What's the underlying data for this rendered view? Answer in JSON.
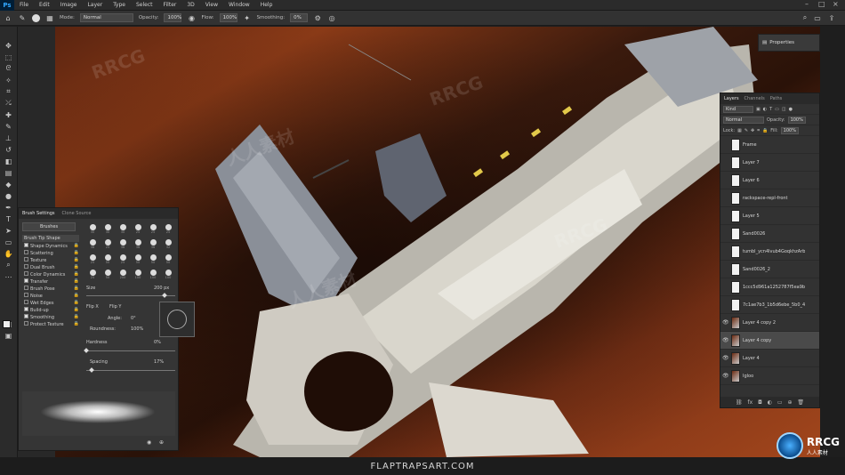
{
  "menu": {
    "logo": "Ps",
    "items": [
      "File",
      "Edit",
      "Image",
      "Layer",
      "Type",
      "Select",
      "Filter",
      "3D",
      "View",
      "Window",
      "Help"
    ]
  },
  "options": {
    "mode_label": "Mode:",
    "mode_value": "Normal",
    "opacity_label": "Opacity:",
    "opacity_value": "100%",
    "flow_label": "Flow:",
    "flow_value": "100%",
    "smoothing_label": "Smoothing:",
    "smoothing_value": "0%"
  },
  "properties": {
    "title": "Properties"
  },
  "layers": {
    "tabs": [
      "Layers",
      "Channels",
      "Paths"
    ],
    "kind": "Kind",
    "blend": "Normal",
    "opacity_label": "Opacity:",
    "opacity": "100%",
    "lock_label": "Lock:",
    "fill_label": "Fill:",
    "fill": "100%",
    "items": [
      {
        "name": "Frame",
        "thumb": "white"
      },
      {
        "name": "Layer 7",
        "thumb": "white"
      },
      {
        "name": "Layer 6",
        "thumb": "white"
      },
      {
        "name": "rackspace-repl-front",
        "thumb": "white"
      },
      {
        "name": "Layer 5",
        "thumb": "white"
      },
      {
        "name": "Sand0026",
        "thumb": "white"
      },
      {
        "name": "tumbl_ycn4lvub4GoqkhzArb1...",
        "thumb": "white"
      },
      {
        "name": "Sand0026_2",
        "thumb": "white"
      },
      {
        "name": "1ccc5d961a1252787f5ea9b03...",
        "thumb": "white"
      },
      {
        "name": "7c1ae7b3_1b5d6ebe_5b0_4942...",
        "thumb": "white"
      },
      {
        "name": "Layer 4 copy 2",
        "thumb": "dark"
      },
      {
        "name": "Layer 4 copy",
        "thumb": "dark"
      },
      {
        "name": "Layer 4",
        "thumb": "dark"
      },
      {
        "name": "Igloo",
        "thumb": "dark"
      }
    ]
  },
  "brush_panel": {
    "tabs": [
      "Brush Settings",
      "Clone Source"
    ],
    "brushes_button": "Brushes",
    "options": [
      {
        "label": "Brush Tip Shape",
        "checked": false,
        "lock": false
      },
      {
        "label": "Shape Dynamics",
        "checked": true,
        "lock": true
      },
      {
        "label": "Scattering",
        "checked": false,
        "lock": true
      },
      {
        "label": "Texture",
        "checked": false,
        "lock": true
      },
      {
        "label": "Dual Brush",
        "checked": false,
        "lock": true
      },
      {
        "label": "Color Dynamics",
        "checked": false,
        "lock": true
      },
      {
        "label": "Transfer",
        "checked": true,
        "lock": true
      },
      {
        "label": "Brush Pose",
        "checked": false,
        "lock": true
      },
      {
        "label": "Noise",
        "checked": false,
        "lock": true
      },
      {
        "label": "Wet Edges",
        "checked": false,
        "lock": true
      },
      {
        "label": "Build-up",
        "checked": true,
        "lock": true
      },
      {
        "label": "Smoothing",
        "checked": true,
        "lock": true
      },
      {
        "label": "Protect Texture",
        "checked": false,
        "lock": true
      }
    ],
    "tip_sizes": [
      "30",
      "30",
      "30",
      "25",
      "25",
      "25",
      "36",
      "25",
      "36",
      "36",
      "36",
      "32",
      "25",
      "50",
      "25",
      "50",
      "50",
      "50",
      "25",
      "50",
      "200",
      "100",
      "100",
      "100"
    ],
    "size_label": "Size",
    "size_value": "200 px",
    "flip_x": "Flip X",
    "flip_y": "Flip Y",
    "angle_label": "Angle:",
    "angle_value": "0°",
    "roundness_label": "Roundness:",
    "roundness_value": "100%",
    "hardness_label": "Hardness",
    "hardness_value": "0%",
    "spacing_label": "Spacing",
    "spacing_value": "17%"
  },
  "watermark": {
    "site": "FLAPTRAPSART.COM",
    "logo_text": "RRCG",
    "logo_sub": "人人素材",
    "tile_text": "RRCG",
    "tile_cn": "人人素材"
  }
}
